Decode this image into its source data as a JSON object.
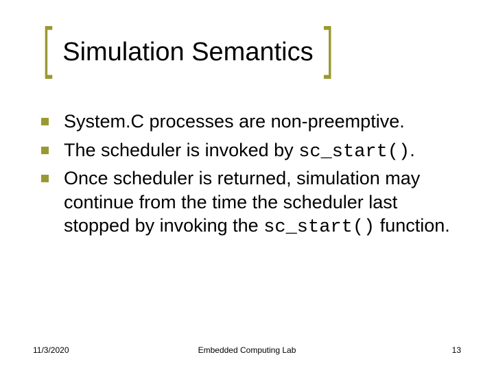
{
  "title": "Simulation Semantics",
  "bullets": [
    {
      "pre": "System.C processes are non-preemptive.",
      "code": "",
      "post": ""
    },
    {
      "pre": "The scheduler is invoked by ",
      "code": "sc_start()",
      "post": "."
    },
    {
      "pre": "Once scheduler is returned, simulation may continue from the time the scheduler last stopped by invoking the ",
      "code": "sc_start()",
      "post": " function."
    }
  ],
  "footer": {
    "date": "11/3/2020",
    "center": "Embedded Computing Lab",
    "page": "13"
  }
}
